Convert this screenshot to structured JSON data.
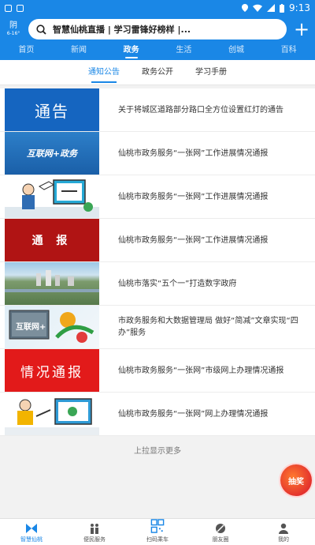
{
  "status_bar": {
    "time": "9:13"
  },
  "header": {
    "weather": {
      "condition": "阴",
      "temp": "6-16°"
    },
    "search_text": "智慧仙桃直播 | 学习雷锋好榜样 |...",
    "plus_icon": "plus-icon"
  },
  "nav_tabs": [
    {
      "label": "首页",
      "active": false
    },
    {
      "label": "新闻",
      "active": false
    },
    {
      "label": "政务",
      "active": true
    },
    {
      "label": "生活",
      "active": false
    },
    {
      "label": "创城",
      "active": false
    },
    {
      "label": "百科",
      "active": false
    }
  ],
  "sub_tabs": [
    {
      "label": "通知公告",
      "active": true
    },
    {
      "label": "政务公开",
      "active": false
    },
    {
      "label": "学习手册",
      "active": false
    }
  ],
  "articles": [
    {
      "title": "关于将城区道路部分路口全方位设置红灯的通告",
      "thumb_text": "通告"
    },
    {
      "title": "仙桃市政务服务“一张网”工作进展情况通报",
      "thumb_text": "互联网+政务"
    },
    {
      "title": "仙桃市政务服务“一张网”工作进展情况通报",
      "thumb_text": ""
    },
    {
      "title": "仙桃市政务服务“一张网”工作进展情况通报",
      "thumb_text": "通 报"
    },
    {
      "title": "仙桃市落实“五个一”打造数字政府",
      "thumb_text": ""
    },
    {
      "title": "市政务服务和大数据管理局 做好“简减”文章实现“四办”服务",
      "thumb_text": "互联网+"
    },
    {
      "title": "仙桃市政务服务“一张网”市级网上办理情况通报",
      "thumb_text": "情况通报"
    },
    {
      "title": "仙桃市政务服务“一张网”网上办理情况通报",
      "thumb_text": ""
    }
  ],
  "load_more": "上拉显示更多",
  "float_badge": "抽奖",
  "bottom_nav": [
    {
      "label": "智慧仙桃",
      "icon": "home-icon",
      "active": true
    },
    {
      "label": "便民服务",
      "icon": "service-icon",
      "active": false
    },
    {
      "label": "扫码乘车",
      "icon": "qr-icon",
      "active": false
    },
    {
      "label": "朋友圈",
      "icon": "friends-icon",
      "active": false
    },
    {
      "label": "我的",
      "icon": "user-icon",
      "active": false
    }
  ]
}
